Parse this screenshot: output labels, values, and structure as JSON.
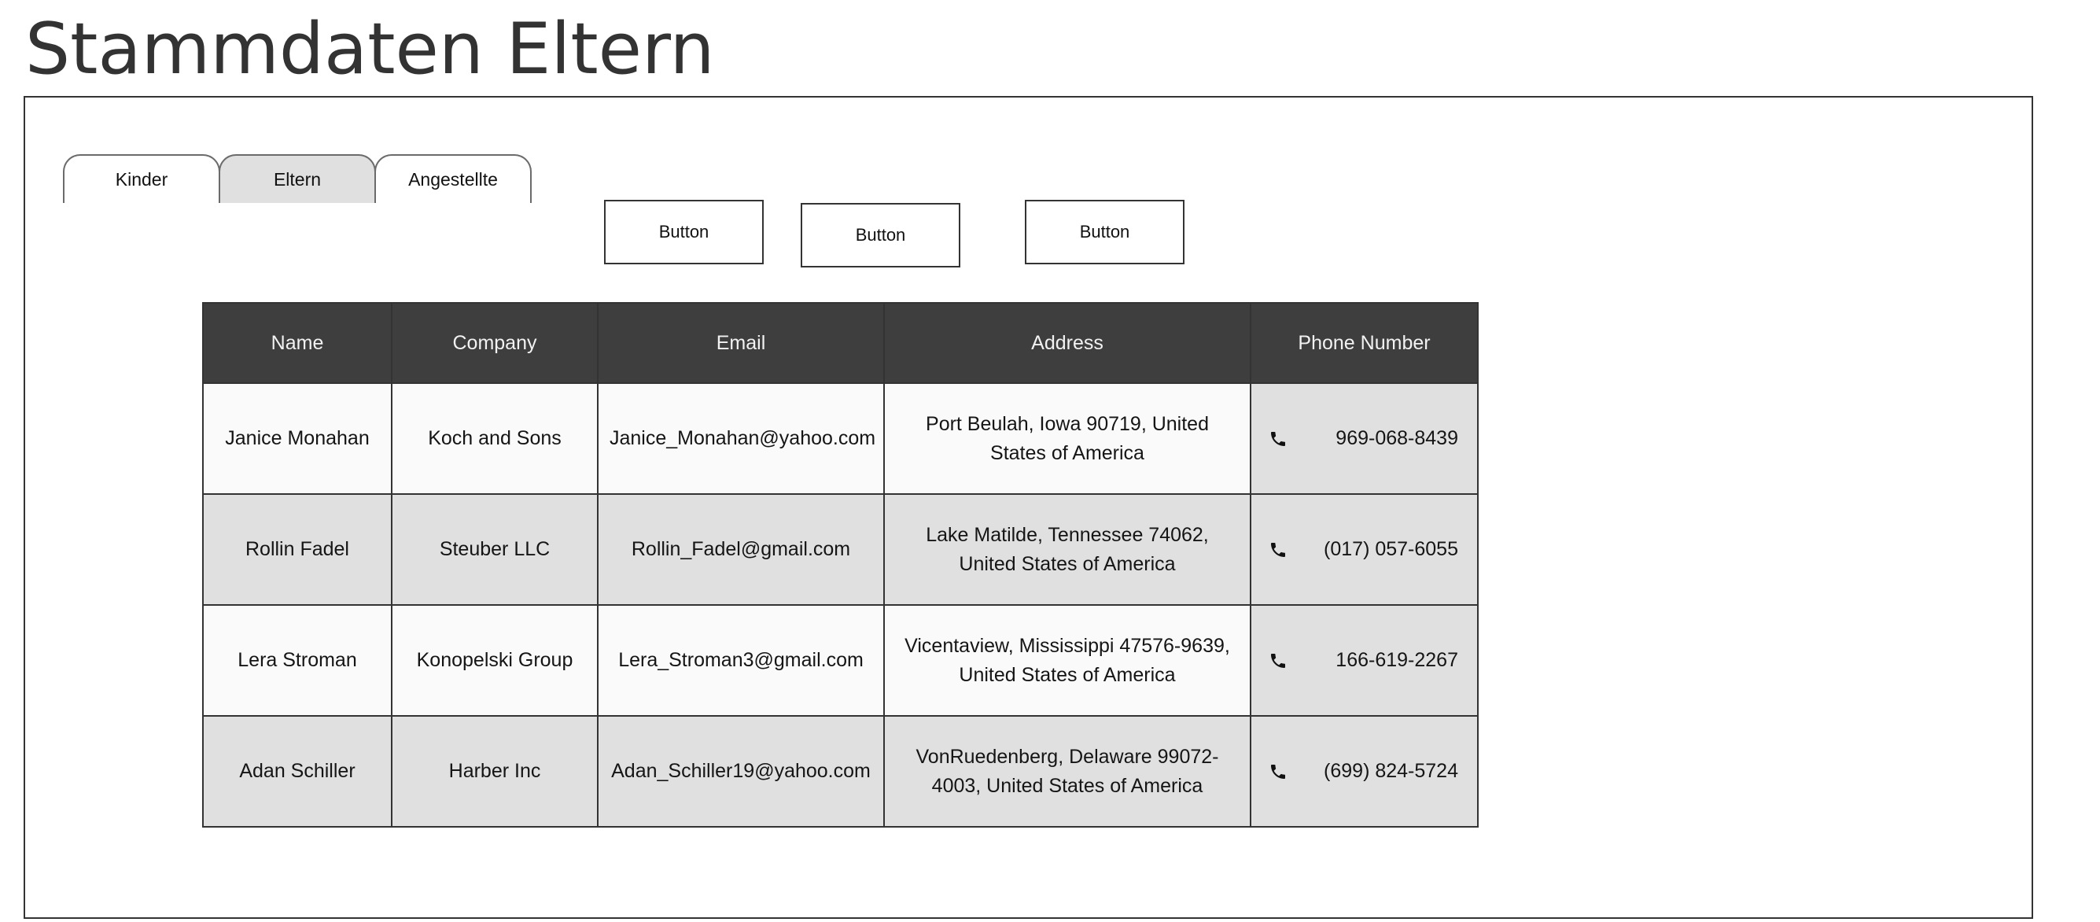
{
  "page": {
    "title": "Stammdaten Eltern"
  },
  "tabs": [
    {
      "label": "Kinder",
      "active": false
    },
    {
      "label": "Eltern",
      "active": true
    },
    {
      "label": "Angestellte",
      "active": false
    }
  ],
  "buttons": [
    {
      "label": "Button"
    },
    {
      "label": "Button"
    },
    {
      "label": "Button"
    }
  ],
  "table": {
    "columns": [
      "Name",
      "Company",
      "Email",
      "Address",
      "Phone Number"
    ],
    "rows": [
      {
        "name": "Janice Monahan",
        "company": "Koch and Sons",
        "email": "Janice_Monahan@yahoo.com",
        "address": "Port Beulah, Iowa 90719, United States of America",
        "phone": "969-068-8439"
      },
      {
        "name": "Rollin Fadel",
        "company": "Steuber LLC",
        "email": "Rollin_Fadel@gmail.com",
        "address": "Lake Matilde, Tennessee 74062, United States of America",
        "phone": "(017) 057-6055"
      },
      {
        "name": "Lera Stroman",
        "company": "Konopelski Group",
        "email": "Lera_Stroman3@gmail.com",
        "address": "Vicentaview, Mississippi 47576-9639, United States of America",
        "phone": "166-619-2267"
      },
      {
        "name": "Adan Schiller",
        "company": "Harber Inc",
        "email": "Adan_Schiller19@yahoo.com",
        "address": "VonRuedenberg, Delaware 99072-4003, United States of America",
        "phone": "(699) 824-5724"
      }
    ]
  },
  "icons": {
    "phone": "phone-icon"
  },
  "colors": {
    "header_bg": "#3e3e3e",
    "header_text": "#f2f2f2",
    "row_light": "#fafafa",
    "row_dark": "#e0e0e0",
    "border": "#333333"
  }
}
